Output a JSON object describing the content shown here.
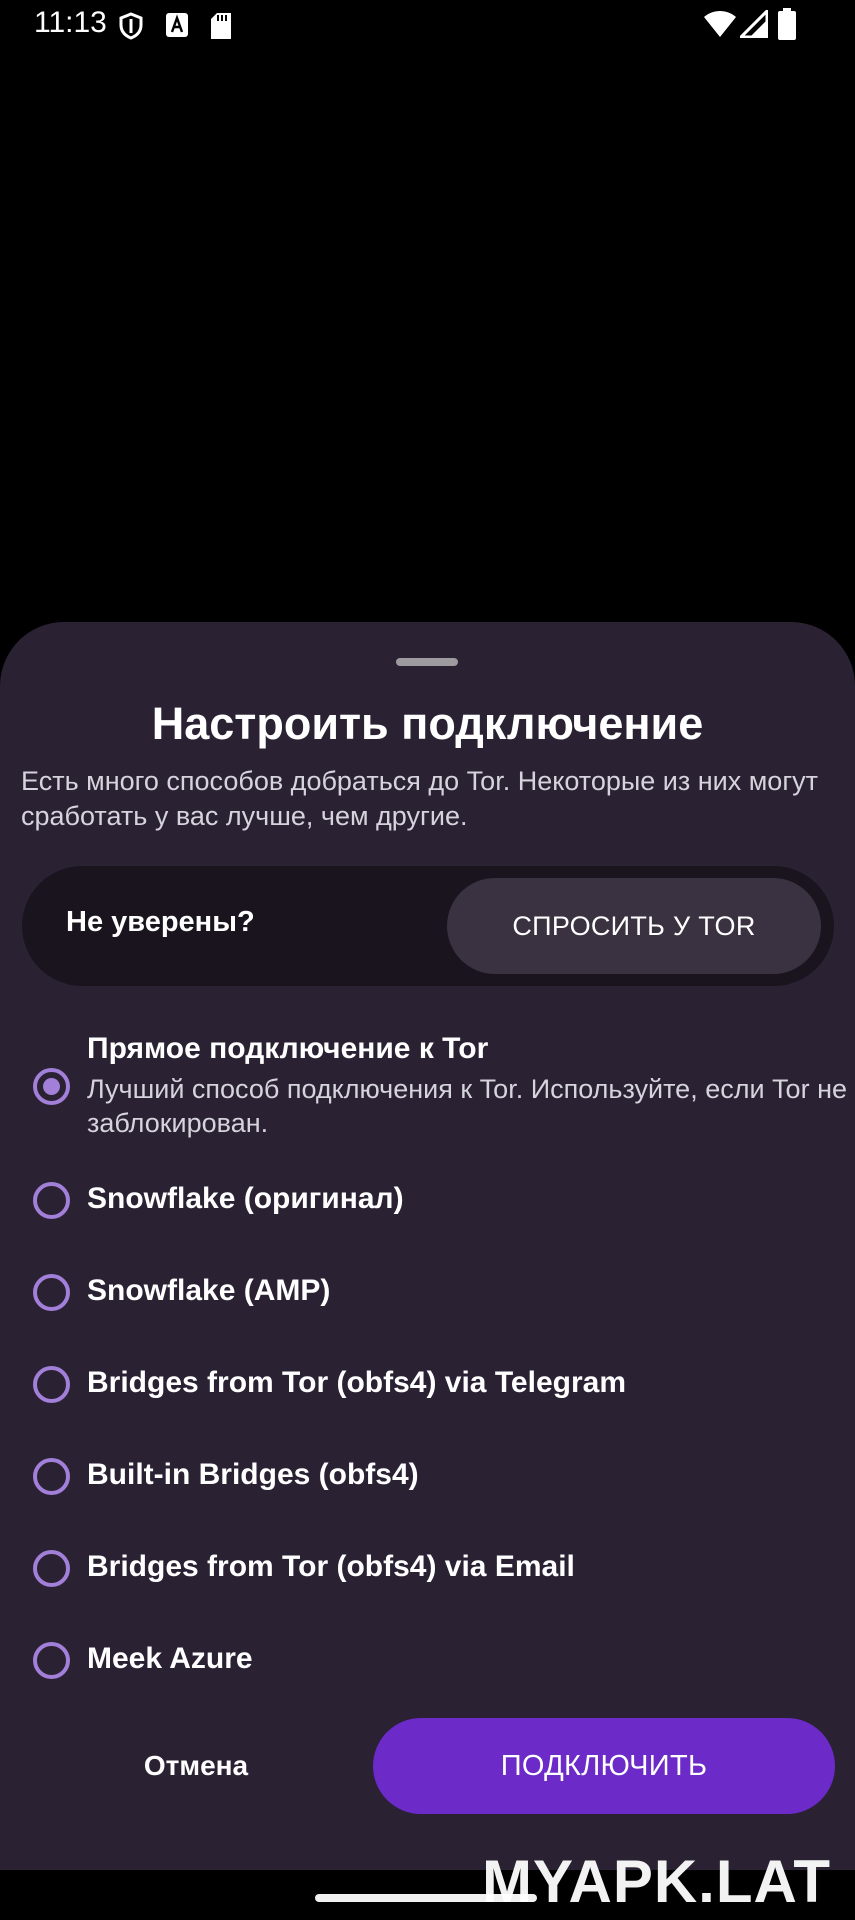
{
  "status_bar": {
    "time": "11:13",
    "left_icons": [
      "shield-icon",
      "font-a-icon",
      "sd-card-icon"
    ],
    "right_icons": [
      "wifi-icon",
      "signal-icon",
      "battery-icon"
    ]
  },
  "sheet": {
    "title": "Настроить подключение",
    "description": "Есть много способов добраться до Tor. Некоторые из них могут сработать у вас лучше, чем другие.",
    "ask": {
      "label": "Не уверены?",
      "button": "СПРОСИТЬ У TOR"
    },
    "options": [
      {
        "title": "Прямое подключение к Tor",
        "subtitle": "Лучший способ подключения к Tor. Используйте, если Tor не заблокирован.",
        "selected": true
      },
      {
        "title": "Snowflake (оригинал)",
        "selected": false
      },
      {
        "title": "Snowflake (AMP)",
        "selected": false
      },
      {
        "title": "Bridges from Tor (obfs4) via Telegram",
        "selected": false
      },
      {
        "title": "Built-in Bridges (obfs4)",
        "selected": false
      },
      {
        "title": "Bridges from Tor (obfs4) via Email",
        "selected": false
      },
      {
        "title": "Meek Azure",
        "selected": false
      }
    ],
    "cancel_label": "Отмена",
    "connect_label": "ПОДКЛЮЧИТЬ"
  },
  "watermark": "MYAPK.LAT",
  "colors": {
    "sheet_bg": "#2a2233",
    "accent": "#a27fd8",
    "primary_button": "#6c2ac9"
  }
}
